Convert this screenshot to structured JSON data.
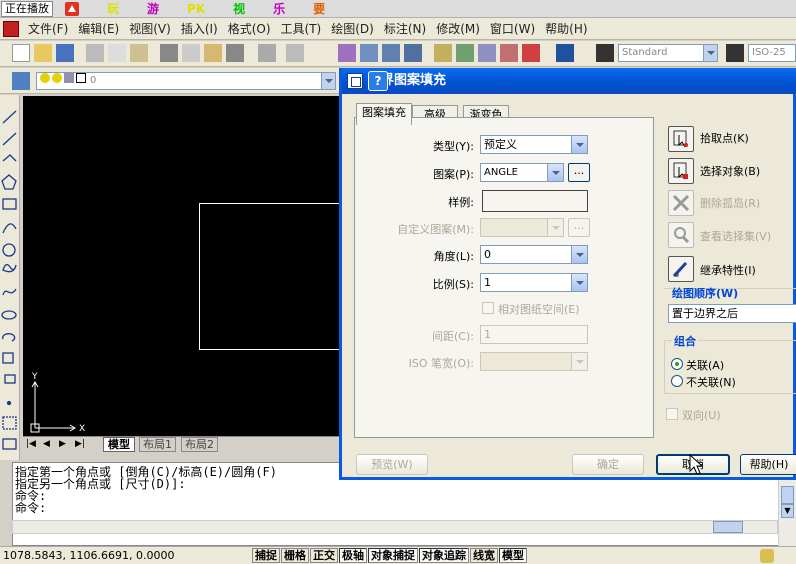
{
  "topbar": {
    "playing": "正在播放",
    "games": [
      "玩",
      "游",
      "PK",
      "视",
      "乐",
      "要"
    ],
    "game_colors": [
      "#e0e000",
      "#c000c0",
      "#e0e000",
      "#00c000",
      "#c000c0",
      "#e06000"
    ]
  },
  "menu": [
    "文件(F)",
    "编辑(E)",
    "视图(V)",
    "插入(I)",
    "格式(O)",
    "工具(T)",
    "绘图(D)",
    "标注(N)",
    "修改(M)",
    "窗口(W)",
    "帮助(H)"
  ],
  "toolbar": {
    "text_style": "Standard",
    "dim_style": "ISO-25",
    "layer": "0"
  },
  "canvas": {
    "tabs": [
      "模型",
      "布局1",
      "布局2"
    ],
    "axis_x": "X",
    "axis_y": "Y"
  },
  "command_lines": [
    "指定第一个角点或 [倒角(C)/标高(E)/圆角(F)",
    "指定另一个角点或 [尺寸(D)]:",
    "命令:",
    "命令:"
  ],
  "status": {
    "coords": "1078.5843, 1106.6691, 0.0000",
    "buttons": [
      "捕捉",
      "栅格",
      "正交",
      "极轴",
      "对象捕捉",
      "对象追踪",
      "线宽",
      "模型"
    ]
  },
  "dialog": {
    "title": "边界图案填充",
    "tabs": [
      "图案填充",
      "高级",
      "渐变色"
    ],
    "type_label": "类型(Y):",
    "type_value": "预定义",
    "pattern_label": "图案(P):",
    "pattern_value": "ANGLE",
    "swatch_label": "样例:",
    "custom_label": "自定义图案(M):",
    "angle_label": "角度(L):",
    "angle_value": "0",
    "scale_label": "比例(S):",
    "scale_value": "1",
    "relative_label": "相对图纸空间(E)",
    "spacing_label": "间距(C):",
    "spacing_value": "1",
    "iso_label": "ISO 笔宽(O):",
    "ellipsis": "...",
    "right_buttons": [
      "拾取点(K)",
      "选择对象(B)",
      "删除孤岛(R)",
      "查看选择集(V)",
      "继承特性(I)"
    ],
    "draw_order_label": "绘图顺序(W)",
    "draw_order_value": "置于边界之后",
    "group_label": "组合",
    "assoc_label": "关联(A)",
    "nonassoc_label": "不关联(N)",
    "double_label": "双向(U)",
    "preview": "预览(W)",
    "ok": "确定",
    "cancel": "取消",
    "help": "帮助(H)"
  }
}
